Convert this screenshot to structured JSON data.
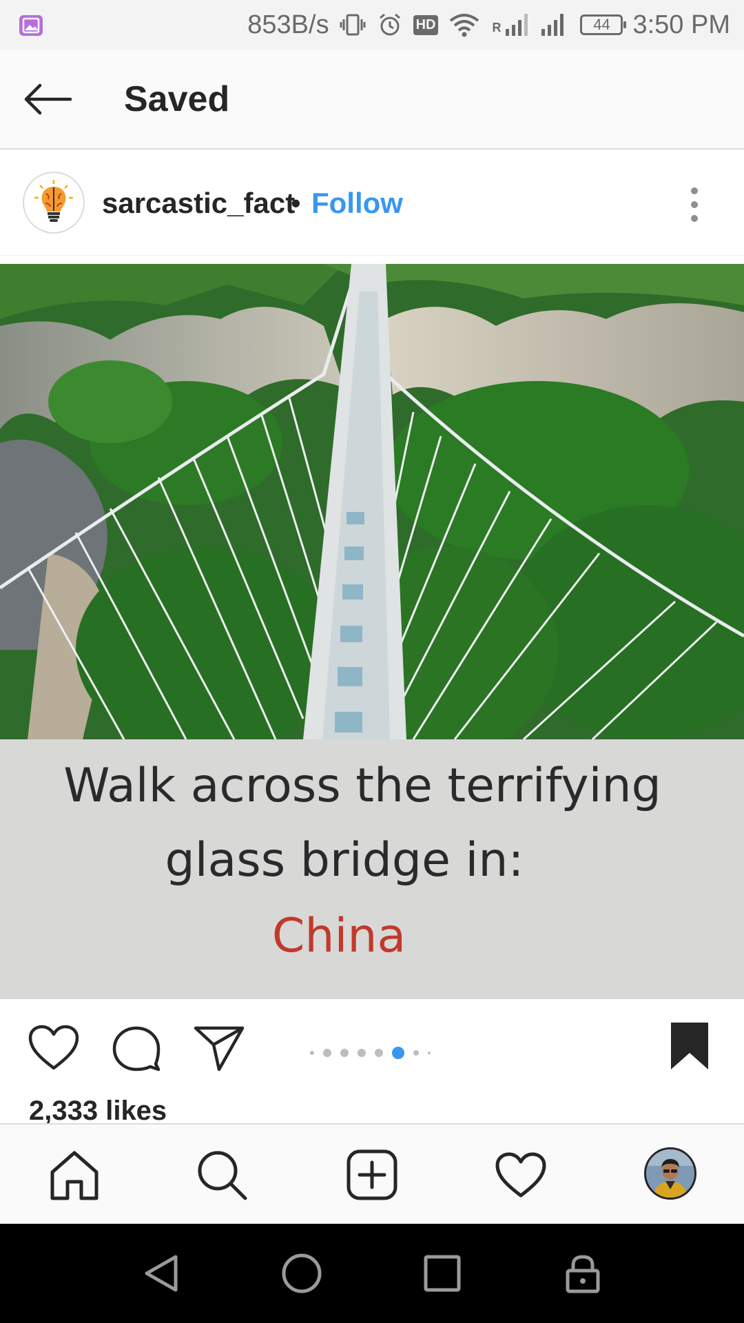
{
  "status_bar": {
    "net_speed": "853B/s",
    "hd_badge": "HD",
    "signal_label": "R",
    "battery": "44",
    "time": "3:50 PM"
  },
  "app_bar": {
    "title": "Saved"
  },
  "post": {
    "username": "sarcastic_fact",
    "separator": "•",
    "follow_label": "Follow",
    "image_caption": {
      "line1": "Walk across the terrifying",
      "line2": "glass bridge in:",
      "line3": "China"
    },
    "likes": "2,333 likes",
    "carousel": {
      "count": 8,
      "active_index": 5,
      "active_color": "#3897f0"
    }
  },
  "colors": {
    "accent": "#3897f0",
    "caption_highlight": "#c0392b"
  },
  "icons": {
    "status": [
      "gallery-icon",
      "vibrate-icon",
      "alarm-icon",
      "wifi-icon",
      "signal-icon",
      "battery-icon"
    ],
    "app_bar": [
      "back-arrow-icon"
    ],
    "post_actions": [
      "heart-icon",
      "comment-icon",
      "share-icon",
      "bookmark-filled-icon"
    ],
    "bottom_nav": [
      "home-icon",
      "search-icon",
      "add-post-icon",
      "activity-heart-icon",
      "profile-avatar"
    ],
    "system_nav": [
      "back-triangle-icon",
      "home-circle-icon",
      "recents-square-icon",
      "lock-icon"
    ]
  }
}
